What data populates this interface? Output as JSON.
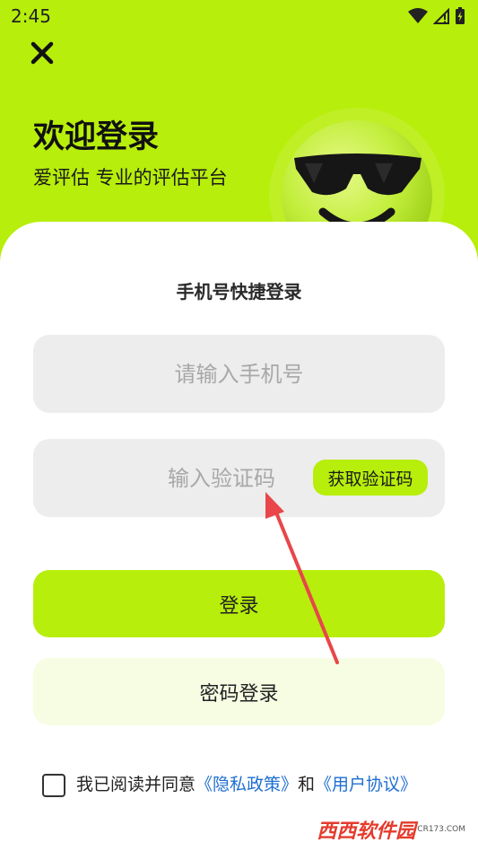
{
  "status_bar": {
    "time": "2:45",
    "icons": [
      "wifi-icon",
      "signal-icon",
      "battery-icon"
    ]
  },
  "header": {
    "close_icon": "close-icon",
    "title": "欢迎登录",
    "subtitle": "爱评估 专业的评估平台",
    "mascot": "sunglasses-smiley-mascot"
  },
  "login_card": {
    "title": "手机号快捷登录",
    "phone_placeholder": "请输入手机号",
    "code_placeholder": "输入验证码",
    "get_code_label": "获取验证码",
    "login_label": "登录",
    "password_login_label": "密码登录",
    "agreement": {
      "prefix": "我已阅读并同意",
      "privacy_link": "《隐私政策》",
      "and": "和",
      "terms_link": "《用户协议》"
    }
  },
  "watermark": {
    "logo": "西西软件园",
    "site": "CR173.COM"
  },
  "colors": {
    "accent": "#b7ee0b",
    "link": "#1e6fd0",
    "input_bg": "#ededed",
    "secondary_button_bg": "#f6fde3",
    "arrow": "#e8464a"
  }
}
